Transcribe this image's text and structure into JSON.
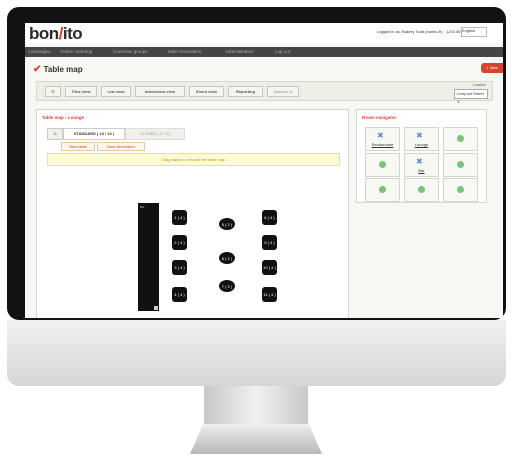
{
  "header": {
    "logo_left": "bon",
    "logo_mark": "/",
    "logo_right": "ito",
    "logged_in": "Logged in as: Bakery Todd (bonito-fr) · 1234 5678",
    "language": "English"
  },
  "nav": [
    "Campaigns",
    "Online reporting",
    "Customer groups",
    "Table reservation",
    "Administration",
    "Log out"
  ],
  "page": {
    "title": "Table map",
    "new_reservation_label": "+ New",
    "check_icon": "check-icon"
  },
  "toolbar": {
    "refresh_icon": "refresh-icon",
    "buttons": [
      "Time view",
      "List view",
      "Interaction view",
      "Event view",
      "Reporting",
      "Options ∨"
    ],
    "location_label": "Location",
    "location_value": "Livepool Street ∨"
  },
  "table_map": {
    "title": "Table map › Lounge",
    "tabs": [
      "STANDARD ( 10 / 10 )",
      "CLOSED ( 0 / 0 )"
    ],
    "sub_tabs": [
      "New table",
      "New decoration"
    ],
    "notice": "Drag tables to rebuild the table map",
    "bar_label": "Bar",
    "tables": [
      {
        "label": "1 ( 4 )",
        "shape": "square"
      },
      {
        "label": "2 ( 4 )",
        "shape": "square"
      },
      {
        "label": "3 ( 4 )",
        "shape": "square"
      },
      {
        "label": "4 ( 4 )",
        "shape": "square"
      },
      {
        "label": "5 ( 2 )",
        "shape": "oval"
      },
      {
        "label": "6 ( 2 )",
        "shape": "oval"
      },
      {
        "label": "7 ( 2 )",
        "shape": "oval"
      },
      {
        "label": "8 ( 4 )",
        "shape": "square"
      },
      {
        "label": "9 ( 4 )",
        "shape": "square"
      },
      {
        "label": "10 ( 4 )",
        "shape": "square"
      },
      {
        "label": "11 ( 4 )",
        "shape": "square"
      }
    ]
  },
  "room_navigator": {
    "title": "Room navigator",
    "rooms": [
      {
        "label": "Restaurante",
        "icon": "room-icon"
      },
      {
        "label": "Lounge",
        "icon": "room-icon"
      },
      {
        "label": "",
        "icon": "status-dot"
      },
      {
        "label": "",
        "icon": "status-dot"
      },
      {
        "label": "Bar",
        "icon": "room-icon"
      },
      {
        "label": "",
        "icon": "status-dot"
      },
      {
        "label": "",
        "icon": "status-dot"
      },
      {
        "label": "",
        "icon": "status-dot"
      },
      {
        "label": "",
        "icon": "status-dot"
      }
    ]
  },
  "colors": {
    "accent": "#d64532",
    "dark": "#454545"
  }
}
